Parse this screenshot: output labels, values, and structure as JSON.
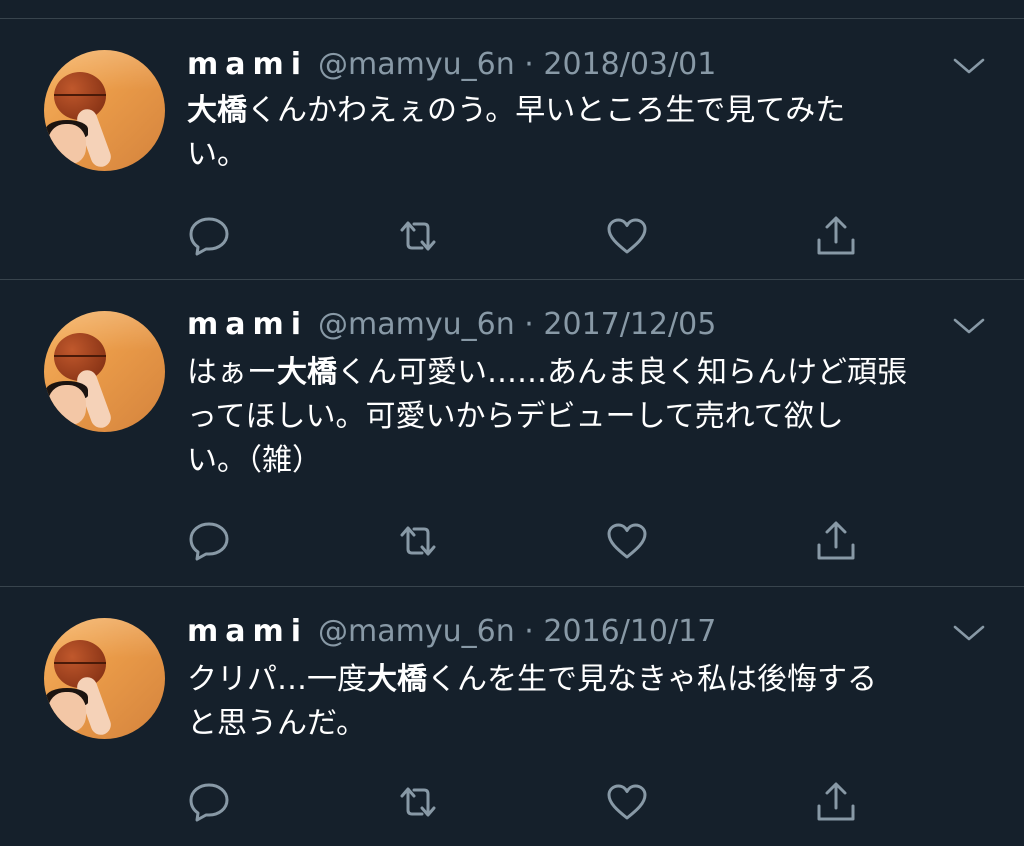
{
  "tweets": [
    {
      "name": "mami",
      "handle": "@mamyu_6n",
      "separator": "·",
      "date": "2018/03/01",
      "lines": [
        [
          {
            "t": "大橋",
            "b": true
          },
          {
            "t": "くんかわえぇのう。早いところ生で見てみた"
          }
        ],
        [
          {
            "t": "い。"
          }
        ]
      ]
    },
    {
      "name": "mami",
      "handle": "@mamyu_6n",
      "separator": "·",
      "date": "2017/12/05",
      "lines": [
        [
          {
            "t": "はぁー"
          },
          {
            "t": "大橋",
            "b": true
          },
          {
            "t": "くん可愛い……あんま良く知らんけど頑張"
          }
        ],
        [
          {
            "t": "ってほしい。可愛いからデビューして売れて欲し"
          }
        ],
        [
          {
            "t": "い。（雑）"
          }
        ]
      ]
    },
    {
      "name": "mami",
      "handle": "@mamyu_6n",
      "separator": "·",
      "date": "2016/10/17",
      "lines": [
        [
          {
            "t": "クリパ…一度"
          },
          {
            "t": "大橋",
            "b": true
          },
          {
            "t": "くんを生で見なきゃ私は後悔する"
          }
        ],
        [
          {
            "t": "と思うんだ。"
          }
        ]
      ]
    }
  ],
  "icons": {
    "caret": "chevron-down-icon",
    "reply": "reply-icon",
    "retweet": "retweet-icon",
    "like": "like-icon",
    "share": "share-icon",
    "avatar": "avatar-photo"
  },
  "colors": {
    "background": "#15202b",
    "divider": "#38444d",
    "secondary_text": "#8899a6",
    "primary_text": "#ffffff"
  }
}
